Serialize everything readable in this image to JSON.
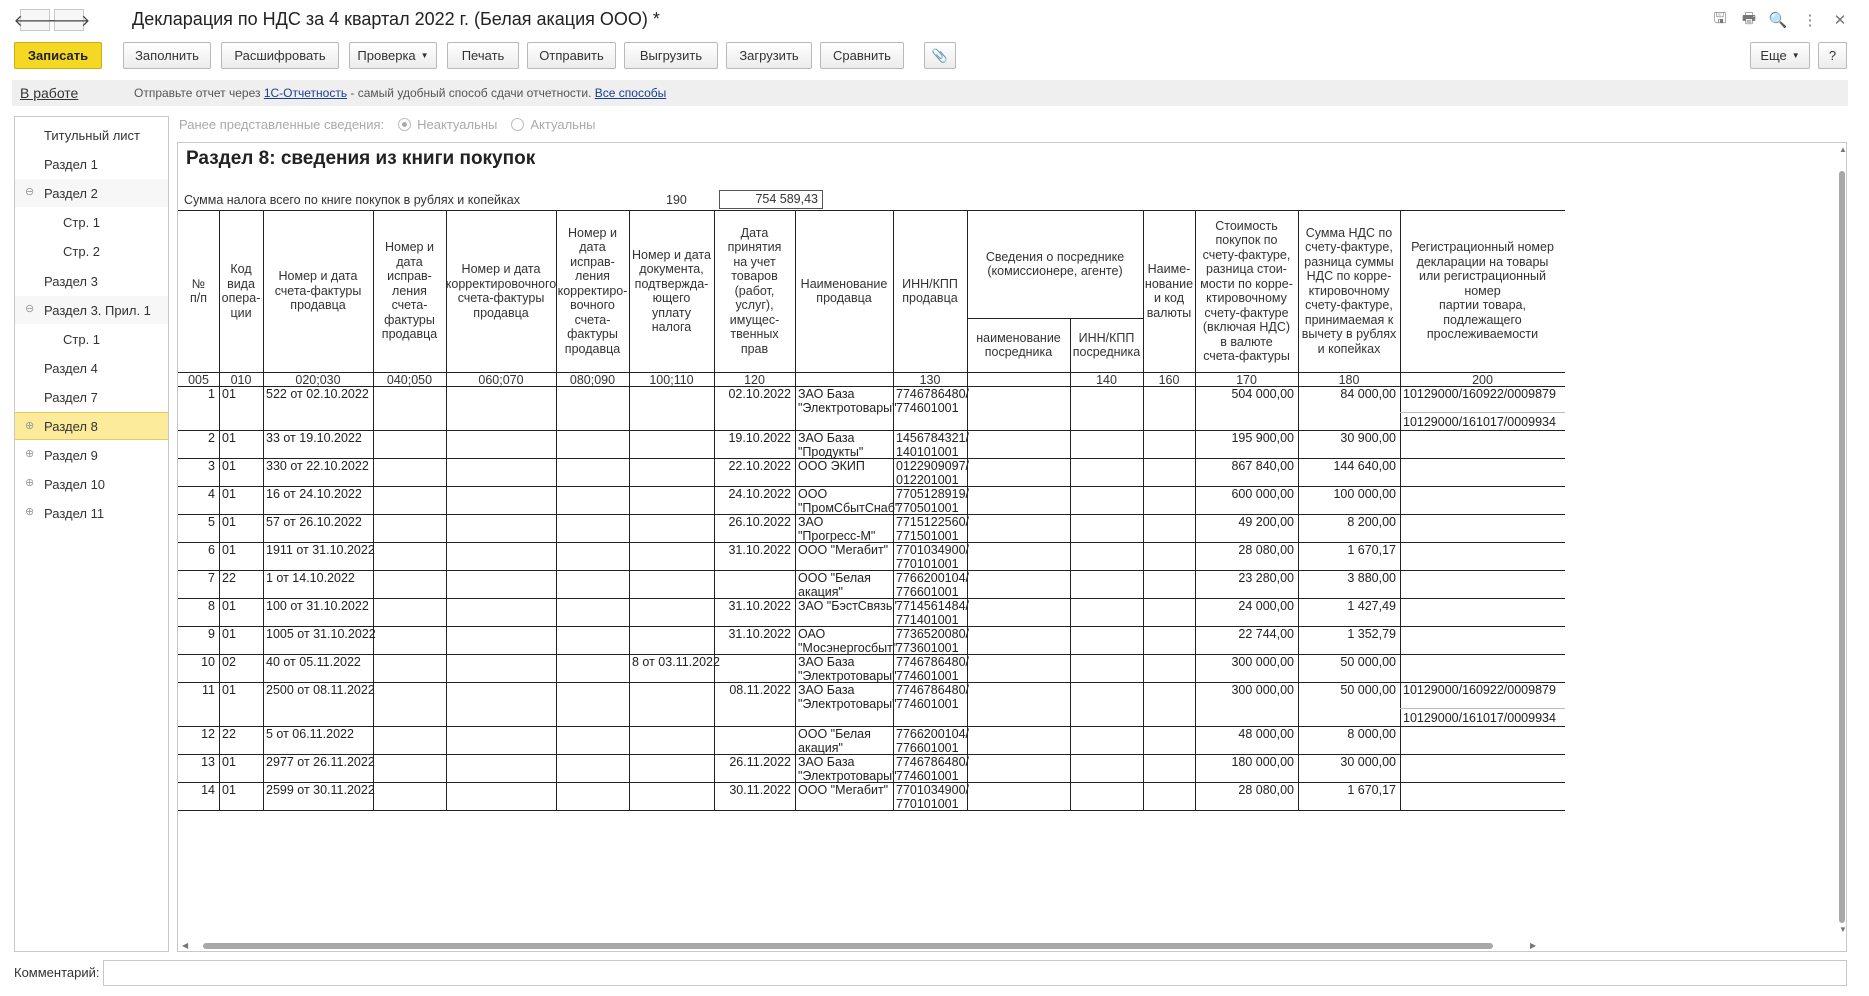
{
  "window": {
    "title": "Декларация по НДС за 4 квартал 2022 г. (Белая акация ООО) *"
  },
  "nav": {
    "back": "🡐",
    "forward": "🡒"
  },
  "title_icons": [
    {
      "name": "save-icon",
      "glyph": "🖫"
    },
    {
      "name": "print-icon",
      "glyph": "🖶"
    },
    {
      "name": "preview-icon",
      "glyph": "🔍"
    },
    {
      "name": "more-vert-icon",
      "glyph": "⋮"
    },
    {
      "name": "close-icon",
      "glyph": "✕"
    }
  ],
  "toolbar": {
    "save": "Записать",
    "fill": "Заполнить",
    "decode": "Расшифровать",
    "check": "Проверка",
    "print": "Печать",
    "send": "Отправить",
    "export": "Выгрузить",
    "import": "Загрузить",
    "compare": "Сравнить",
    "attach_icon": "📎",
    "more": "Еще",
    "help": "?"
  },
  "infobar": {
    "status": "В работе",
    "text_before": "Отправьте отчет через ",
    "link1": "1С-Отчетность",
    "text_after": " - самый удобный способ сдачи отчетности. ",
    "link2": "Все способы"
  },
  "sidebar": {
    "items": [
      {
        "label": "Титульный лист",
        "level": 0,
        "exp": ""
      },
      {
        "label": "Раздел 1",
        "level": 0,
        "exp": ""
      },
      {
        "label": "Раздел 2",
        "level": 0,
        "exp": "⊖"
      },
      {
        "label": "Стр. 1",
        "level": 1,
        "exp": ""
      },
      {
        "label": "Стр. 2",
        "level": 1,
        "exp": ""
      },
      {
        "label": "Раздел 3",
        "level": 0,
        "exp": ""
      },
      {
        "label": "Раздел 3. Прил. 1",
        "level": 0,
        "exp": "⊖"
      },
      {
        "label": "Стр. 1",
        "level": 1,
        "exp": ""
      },
      {
        "label": "Раздел 4",
        "level": 0,
        "exp": ""
      },
      {
        "label": "Раздел 7",
        "level": 0,
        "exp": ""
      },
      {
        "label": "Раздел 8",
        "level": 0,
        "exp": "⊕",
        "active": true
      },
      {
        "label": "Раздел 9",
        "level": 0,
        "exp": "⊕"
      },
      {
        "label": "Раздел 10",
        "level": 0,
        "exp": "⊕"
      },
      {
        "label": "Раздел 11",
        "level": 0,
        "exp": "⊕"
      }
    ]
  },
  "prev_info": {
    "label": "Ранее представленные сведения:",
    "opt1": "Неактуальны",
    "opt2": "Актуальны"
  },
  "doc": {
    "title": "Раздел 8: сведения из книги покупок",
    "sum_label": "Сумма налога всего по книге покупок в рублях и копейках",
    "sum_code": "190",
    "sum_value": "754 589,43"
  },
  "table": {
    "headers": [
      "№\nп/п",
      "Код\nвида\nопера-\nции",
      "Номер и дата\nсчета-фактуры\nпродавца",
      "Номер и\nдата\nисправ-\nления\nсчета-\nфактуры\nпродавца",
      "Номер и дата\nкорректировочного\nсчета-фактуры\nпродавца",
      "Номер и\nдата исправ-\nления\nкорректиро-\nвочного\nсчета-\nфактуры\nпродавца",
      "Номер и дата\nдокумента,\nподтвержда-\nющего\nуплату налога",
      "Дата\nпринятия\nна учет\nтоваров\n(работ, услуг),\nимущес-\nтвенных прав",
      "Наименование\nпродавца",
      "ИНН/КПП\nпродавца",
      "Сведения о посреднике\n(комиссионере, агенте)",
      "Наиме-\nнование\nи код\nвалюты",
      "Стоимость\nпокупок по\nсчету-фактуре,\nразница стои-\nмости по корре-\nктировочному\nсчету-фактуре\n(включая НДС)\nв валюте\nсчета-фактуры",
      "Сумма НДС по\nсчету-фактуре,\nразница суммы\nНДС по корре-\nктировочному\nсчету-фактуре,\nпринимаемая к\nвычету в рублях\nи копейках",
      "Регистрационный номер\nдекларации на товары\nили регистрационный номер\nпартии товара, подлежащего\nпрослеживаемости"
    ],
    "sub_headers": [
      "наименование\nпосредника",
      "ИНН/КПП\nпосредника"
    ],
    "codes": [
      "005",
      "010",
      "020;030",
      "040;050",
      "060;070",
      "080;090",
      "100;110",
      "120",
      "",
      "130",
      "",
      "140",
      "160",
      "170",
      "180",
      "200"
    ],
    "rows": [
      {
        "n": "1",
        "op": "01",
        "inv": "522 от 02.10.2022",
        "pay": "",
        "date": "02.10.2022",
        "seller": [
          "ЗАО База",
          "\"Электротовары\""
        ],
        "inn": [
          "7746786480/",
          "774601001"
        ],
        "cost": "504 000,00",
        "vat": "84 000,00",
        "reg": [
          "10129000/160922/0009879",
          "10129000/161017/0009934"
        ]
      },
      {
        "n": "2",
        "op": "01",
        "inv": "33 от 19.10.2022",
        "pay": "",
        "date": "19.10.2022",
        "seller": [
          "ЗАО База",
          "\"Продукты\""
        ],
        "inn": [
          "1456784321/",
          "140101001"
        ],
        "cost": "195 900,00",
        "vat": "30 900,00",
        "reg": []
      },
      {
        "n": "3",
        "op": "01",
        "inv": "330 от 22.10.2022",
        "pay": "",
        "date": "22.10.2022",
        "seller": [
          "ООО ЭКИП"
        ],
        "inn": [
          "0122909097/",
          "012201001"
        ],
        "cost": "867 840,00",
        "vat": "144 640,00",
        "reg": []
      },
      {
        "n": "4",
        "op": "01",
        "inv": "16 от 24.10.2022",
        "pay": "",
        "date": "24.10.2022",
        "seller": [
          "ООО",
          "\"ПромСбытСнаб\""
        ],
        "inn": [
          "7705128919/",
          "770501001"
        ],
        "cost": "600 000,00",
        "vat": "100 000,00",
        "reg": []
      },
      {
        "n": "5",
        "op": "01",
        "inv": "57 от 26.10.2022",
        "pay": "",
        "date": "26.10.2022",
        "seller": [
          "ЗАО",
          "\"Прогресс-М\""
        ],
        "inn": [
          "7715122560/",
          "771501001"
        ],
        "cost": "49 200,00",
        "vat": "8 200,00",
        "reg": []
      },
      {
        "n": "6",
        "op": "01",
        "inv": "1911 от 31.10.2022",
        "pay": "",
        "date": "31.10.2022",
        "seller": [
          "ООО \"Мегабит\""
        ],
        "inn": [
          "7701034900/",
          "770101001"
        ],
        "cost": "28 080,00",
        "vat": "1 670,17",
        "reg": []
      },
      {
        "n": "7",
        "op": "22",
        "inv": "1 от 14.10.2022",
        "pay": "",
        "date": "",
        "seller": [
          "ООО \"Белая",
          "акация\""
        ],
        "inn": [
          "7766200104/",
          "776601001"
        ],
        "cost": "23 280,00",
        "vat": "3 880,00",
        "reg": []
      },
      {
        "n": "8",
        "op": "01",
        "inv": "100 от 31.10.2022",
        "pay": "",
        "date": "31.10.2022",
        "seller": [
          "ЗАО \"БэстСвязь\""
        ],
        "inn": [
          "7714561484/",
          "771401001"
        ],
        "cost": "24 000,00",
        "vat": "1 427,49",
        "reg": []
      },
      {
        "n": "9",
        "op": "01",
        "inv": "1005 от 31.10.2022",
        "pay": "",
        "date": "31.10.2022",
        "seller": [
          "ОАО",
          "\"Мосэнергосбыт\""
        ],
        "inn": [
          "7736520080/",
          "773601001"
        ],
        "cost": "22 744,00",
        "vat": "1 352,79",
        "reg": []
      },
      {
        "n": "10",
        "op": "02",
        "inv": "40 от 05.11.2022",
        "pay": "8 от 03.11.2022",
        "date": "",
        "seller": [
          "ЗАО База",
          "\"Электротовары\""
        ],
        "inn": [
          "7746786480/",
          "774601001"
        ],
        "cost": "300 000,00",
        "vat": "50 000,00",
        "reg": []
      },
      {
        "n": "11",
        "op": "01",
        "inv": "2500 от 08.11.2022",
        "pay": "",
        "date": "08.11.2022",
        "seller": [
          "ЗАО База",
          "\"Электротовары\""
        ],
        "inn": [
          "7746786480/",
          "774601001"
        ],
        "cost": "300 000,00",
        "vat": "50 000,00",
        "reg": [
          "10129000/160922/0009879",
          "10129000/161017/0009934"
        ]
      },
      {
        "n": "12",
        "op": "22",
        "inv": "5 от 06.11.2022",
        "pay": "",
        "date": "",
        "seller": [
          "ООО \"Белая",
          "акация\""
        ],
        "inn": [
          "7766200104/",
          "776601001"
        ],
        "cost": "48 000,00",
        "vat": "8 000,00",
        "reg": []
      },
      {
        "n": "13",
        "op": "01",
        "inv": "2977 от 26.11.2022",
        "pay": "",
        "date": "26.11.2022",
        "seller": [
          "ЗАО База",
          "\"Электротовары\""
        ],
        "inn": [
          "7746786480/",
          "774601001"
        ],
        "cost": "180 000,00",
        "vat": "30 000,00",
        "reg": []
      },
      {
        "n": "14",
        "op": "01",
        "inv": "2599 от 30.11.2022",
        "pay": "",
        "date": "30.11.2022",
        "seller": [
          "ООО \"Мегабит\""
        ],
        "inn": [
          "7701034900/",
          "770101001"
        ],
        "cost": "28 080,00",
        "vat": "1 670,17",
        "reg": []
      }
    ]
  },
  "footer": {
    "comment_label": "Комментарий:",
    "comment_value": ""
  },
  "colors": {
    "accent": "#f4d823",
    "active_item": "#fbeb9a",
    "link": "#1a3f8c"
  }
}
